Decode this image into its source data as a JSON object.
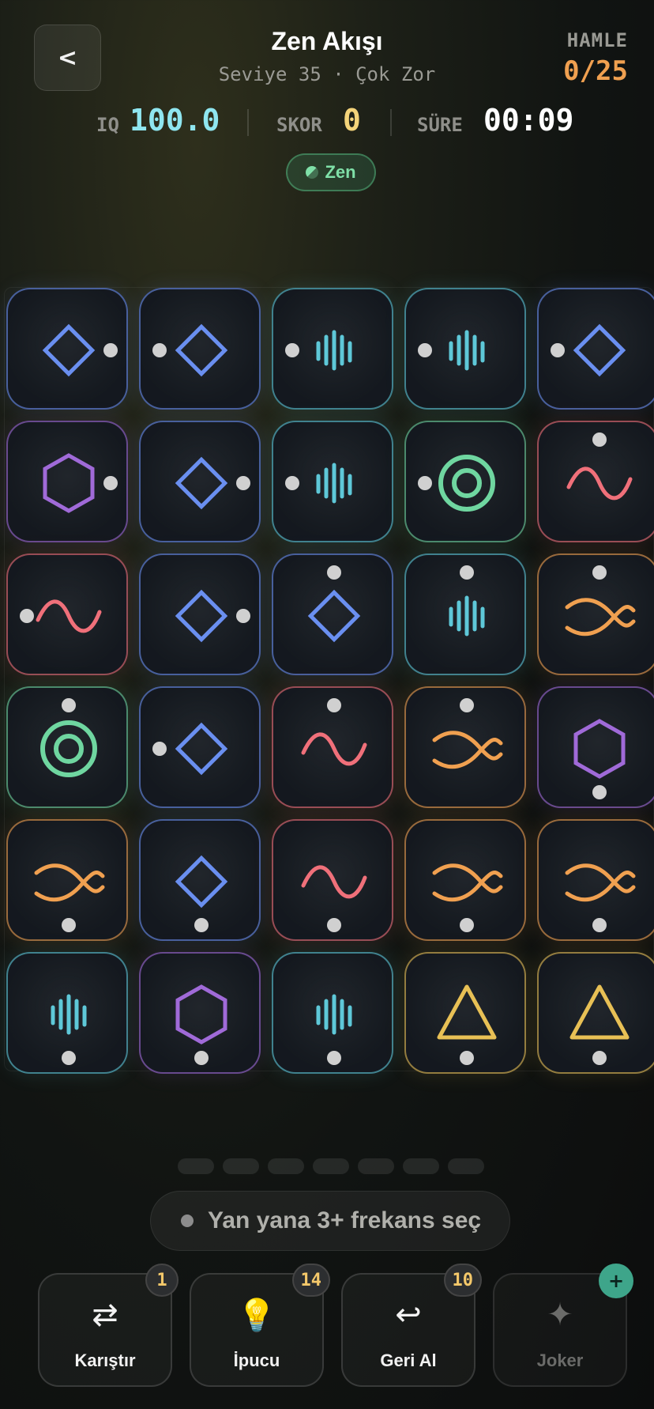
{
  "header": {
    "back_label": "<",
    "title": "Zen Akışı",
    "subtitle": "Seviye 35 · Çok Zor",
    "moves_label": "HAMLE",
    "moves_value": "0/25"
  },
  "stats": {
    "iq_label": "IQ",
    "iq_value": "100.0",
    "score_label": "SKOR",
    "score_value": "0",
    "time_label": "SÜRE",
    "time_value": "00:09"
  },
  "mode": {
    "label": "Zen"
  },
  "colors": {
    "blue": "#6a8ff0",
    "teal": "#5ec8d8",
    "green": "#6fd6a0",
    "purple": "#a06ad8",
    "red": "#f0707a",
    "orange": "#f0a050",
    "yellow": "#e8c055",
    "iq": "#8fe6f0",
    "score": "#f4d47a"
  },
  "board": {
    "rows": [
      [
        {
          "symbol": "diamond",
          "color": "blue",
          "dot": "right"
        },
        {
          "symbol": "diamond",
          "color": "blue",
          "dot": "left"
        },
        {
          "symbol": "bars",
          "color": "teal",
          "dot": "left"
        },
        {
          "symbol": "bars",
          "color": "teal",
          "dot": "left"
        },
        {
          "symbol": "diamond",
          "color": "blue",
          "dot": "left"
        }
      ],
      [
        {
          "symbol": "hexagon",
          "color": "purple",
          "dot": "right"
        },
        {
          "symbol": "diamond",
          "color": "blue",
          "dot": "right"
        },
        {
          "symbol": "bars",
          "color": "teal",
          "dot": "left"
        },
        {
          "symbol": "rings",
          "color": "green",
          "dot": "left"
        },
        {
          "symbol": "wave",
          "color": "red",
          "dot": "top"
        }
      ],
      [
        {
          "symbol": "wave",
          "color": "red",
          "dot": "left"
        },
        {
          "symbol": "diamond",
          "color": "blue",
          "dot": "right"
        },
        {
          "symbol": "diamond",
          "color": "blue",
          "dot": "top"
        },
        {
          "symbol": "bars",
          "color": "teal",
          "dot": "top"
        },
        {
          "symbol": "twist",
          "color": "orange",
          "dot": "top"
        }
      ],
      [
        {
          "symbol": "rings",
          "color": "green",
          "dot": "top"
        },
        {
          "symbol": "diamond",
          "color": "blue",
          "dot": "left"
        },
        {
          "symbol": "wave",
          "color": "red",
          "dot": "top"
        },
        {
          "symbol": "twist",
          "color": "orange",
          "dot": "top"
        },
        {
          "symbol": "hexagon",
          "color": "purple",
          "dot": "bottom"
        }
      ],
      [
        {
          "symbol": "twist",
          "color": "orange",
          "dot": "bottom"
        },
        {
          "symbol": "diamond",
          "color": "blue",
          "dot": "bottom"
        },
        {
          "symbol": "wave",
          "color": "red",
          "dot": "bottom"
        },
        {
          "symbol": "twist",
          "color": "orange",
          "dot": "bottom"
        },
        {
          "symbol": "twist",
          "color": "orange",
          "dot": "bottom"
        }
      ],
      [
        {
          "symbol": "bars",
          "color": "teal",
          "dot": "bottom"
        },
        {
          "symbol": "hexagon",
          "color": "purple",
          "dot": "bottom"
        },
        {
          "symbol": "bars",
          "color": "teal",
          "dot": "bottom"
        },
        {
          "symbol": "triangle",
          "color": "yellow",
          "dot": "bottom"
        },
        {
          "symbol": "triangle",
          "color": "yellow",
          "dot": "bottom"
        }
      ]
    ]
  },
  "pager": {
    "count": 7
  },
  "hint": {
    "text": "Yan yana 3+ frekans seç"
  },
  "tools": [
    {
      "label": "Karıştır",
      "icon": "shuffle-icon",
      "glyph": "⇄",
      "badge": "1"
    },
    {
      "label": "İpucu",
      "icon": "lightbulb-icon",
      "glyph": "💡",
      "badge": "14"
    },
    {
      "label": "Geri Al",
      "icon": "undo-icon",
      "glyph": "↩",
      "badge": "10"
    },
    {
      "label": "Joker",
      "icon": "sparkle-icon",
      "glyph": "✦",
      "badge": "+"
    }
  ]
}
